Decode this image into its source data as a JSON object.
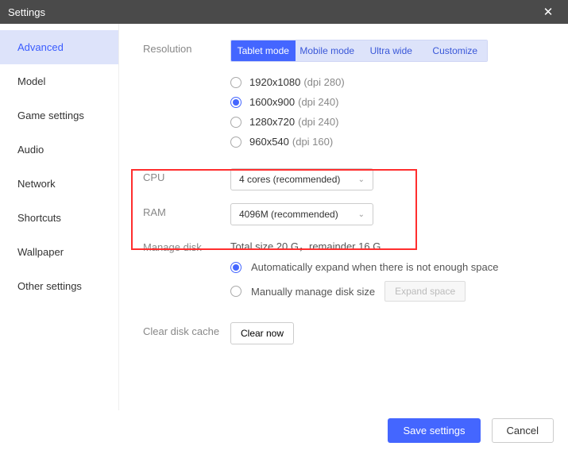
{
  "window": {
    "title": "Settings"
  },
  "sidebar": {
    "items": [
      {
        "label": "Advanced",
        "active": true
      },
      {
        "label": "Model"
      },
      {
        "label": "Game settings"
      },
      {
        "label": "Audio"
      },
      {
        "label": "Network"
      },
      {
        "label": "Shortcuts"
      },
      {
        "label": "Wallpaper"
      },
      {
        "label": "Other settings"
      }
    ]
  },
  "resolution": {
    "label": "Resolution",
    "modes": {
      "tablet": "Tablet mode",
      "mobile": "Mobile mode",
      "ultra": "Ultra wide",
      "custom": "Customize"
    },
    "options": [
      {
        "res": "1920x1080",
        "dpi": "(dpi 280)"
      },
      {
        "res": "1600x900",
        "dpi": "(dpi 240)",
        "checked": true
      },
      {
        "res": "1280x720",
        "dpi": "(dpi 240)"
      },
      {
        "res": "960x540",
        "dpi": "(dpi 160)"
      }
    ]
  },
  "cpu": {
    "label": "CPU",
    "value": "4 cores (recommended)"
  },
  "ram": {
    "label": "RAM",
    "value": "4096M (recommended)"
  },
  "disk": {
    "label": "Manage disk",
    "info": "Total size 20 G，remainder 16 G",
    "auto": "Automatically expand when there is not enough space",
    "manual": "Manually manage disk size",
    "expand": "Expand space"
  },
  "clear": {
    "label": "Clear disk cache",
    "button": "Clear now"
  },
  "footer": {
    "save": "Save settings",
    "cancel": "Cancel"
  }
}
